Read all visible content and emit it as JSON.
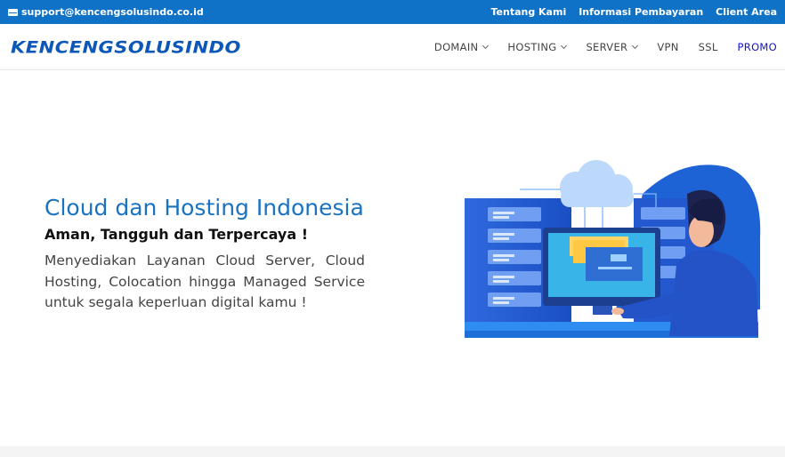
{
  "topbar": {
    "email": "support@kencengsolusindo.co.id",
    "links": [
      "Tentang Kami",
      "Informasi Pembayaran",
      "Client Area"
    ]
  },
  "navbar": {
    "logo_text": "KENCENGSOLUSINDO",
    "items": {
      "domain": "DOMAIN",
      "hosting": "HOSTING",
      "server": "SERVER",
      "vpn": "VPN",
      "ssl": "SSL",
      "promo": "PROMO"
    }
  },
  "hero": {
    "title": "Cloud dan Hosting Indonesia",
    "subtitle": "Aman, Tangguh dan Terpercaya !",
    "description": "Menyediakan Layanan Cloud Server, Cloud Hosting, Colocation hingga Managed Service untuk segala keperluan digital kamu !"
  },
  "colors": {
    "topbar": "#0f72c6",
    "brand": "#0d57b8",
    "title": "#1a73c1",
    "promo": "#1414c8"
  },
  "icons": {
    "email": "mail-icon",
    "dropdown": "chevron-down-icon"
  }
}
